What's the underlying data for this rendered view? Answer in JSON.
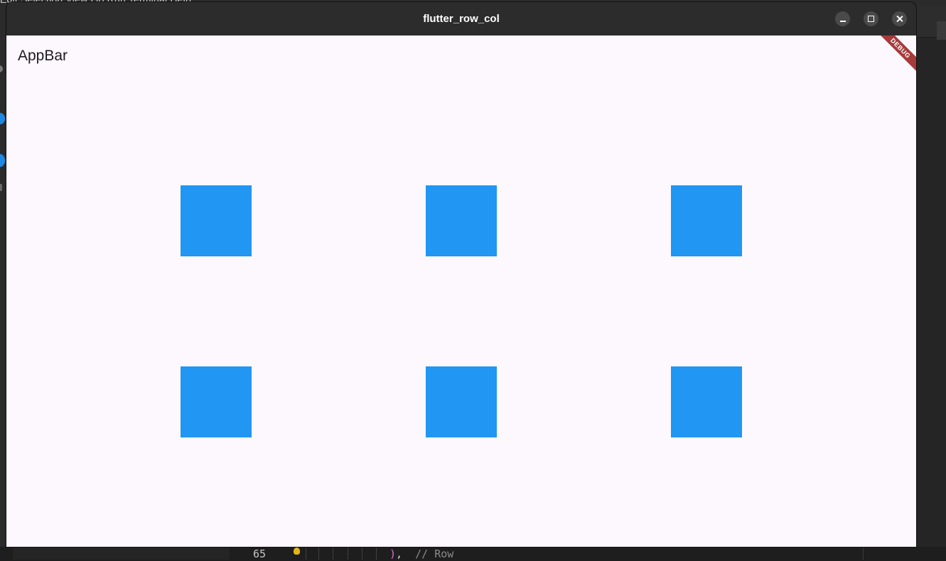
{
  "ide": {
    "menu_items": [
      "Edit",
      "Selection",
      "View",
      "Go",
      "Run",
      "Terminal",
      "Help"
    ],
    "editor": {
      "line_number": "65",
      "code_paren": ")",
      "code_rest": ",",
      "code_comment": "// Row"
    }
  },
  "window": {
    "title": "flutter_row_col",
    "controls": [
      "minimize",
      "maximize",
      "close"
    ]
  },
  "app": {
    "appbar_title": "AppBar",
    "debug_banner": "DEBUG",
    "box_color": "#2196f3",
    "grid": {
      "rows": 2,
      "columns": 3
    }
  }
}
